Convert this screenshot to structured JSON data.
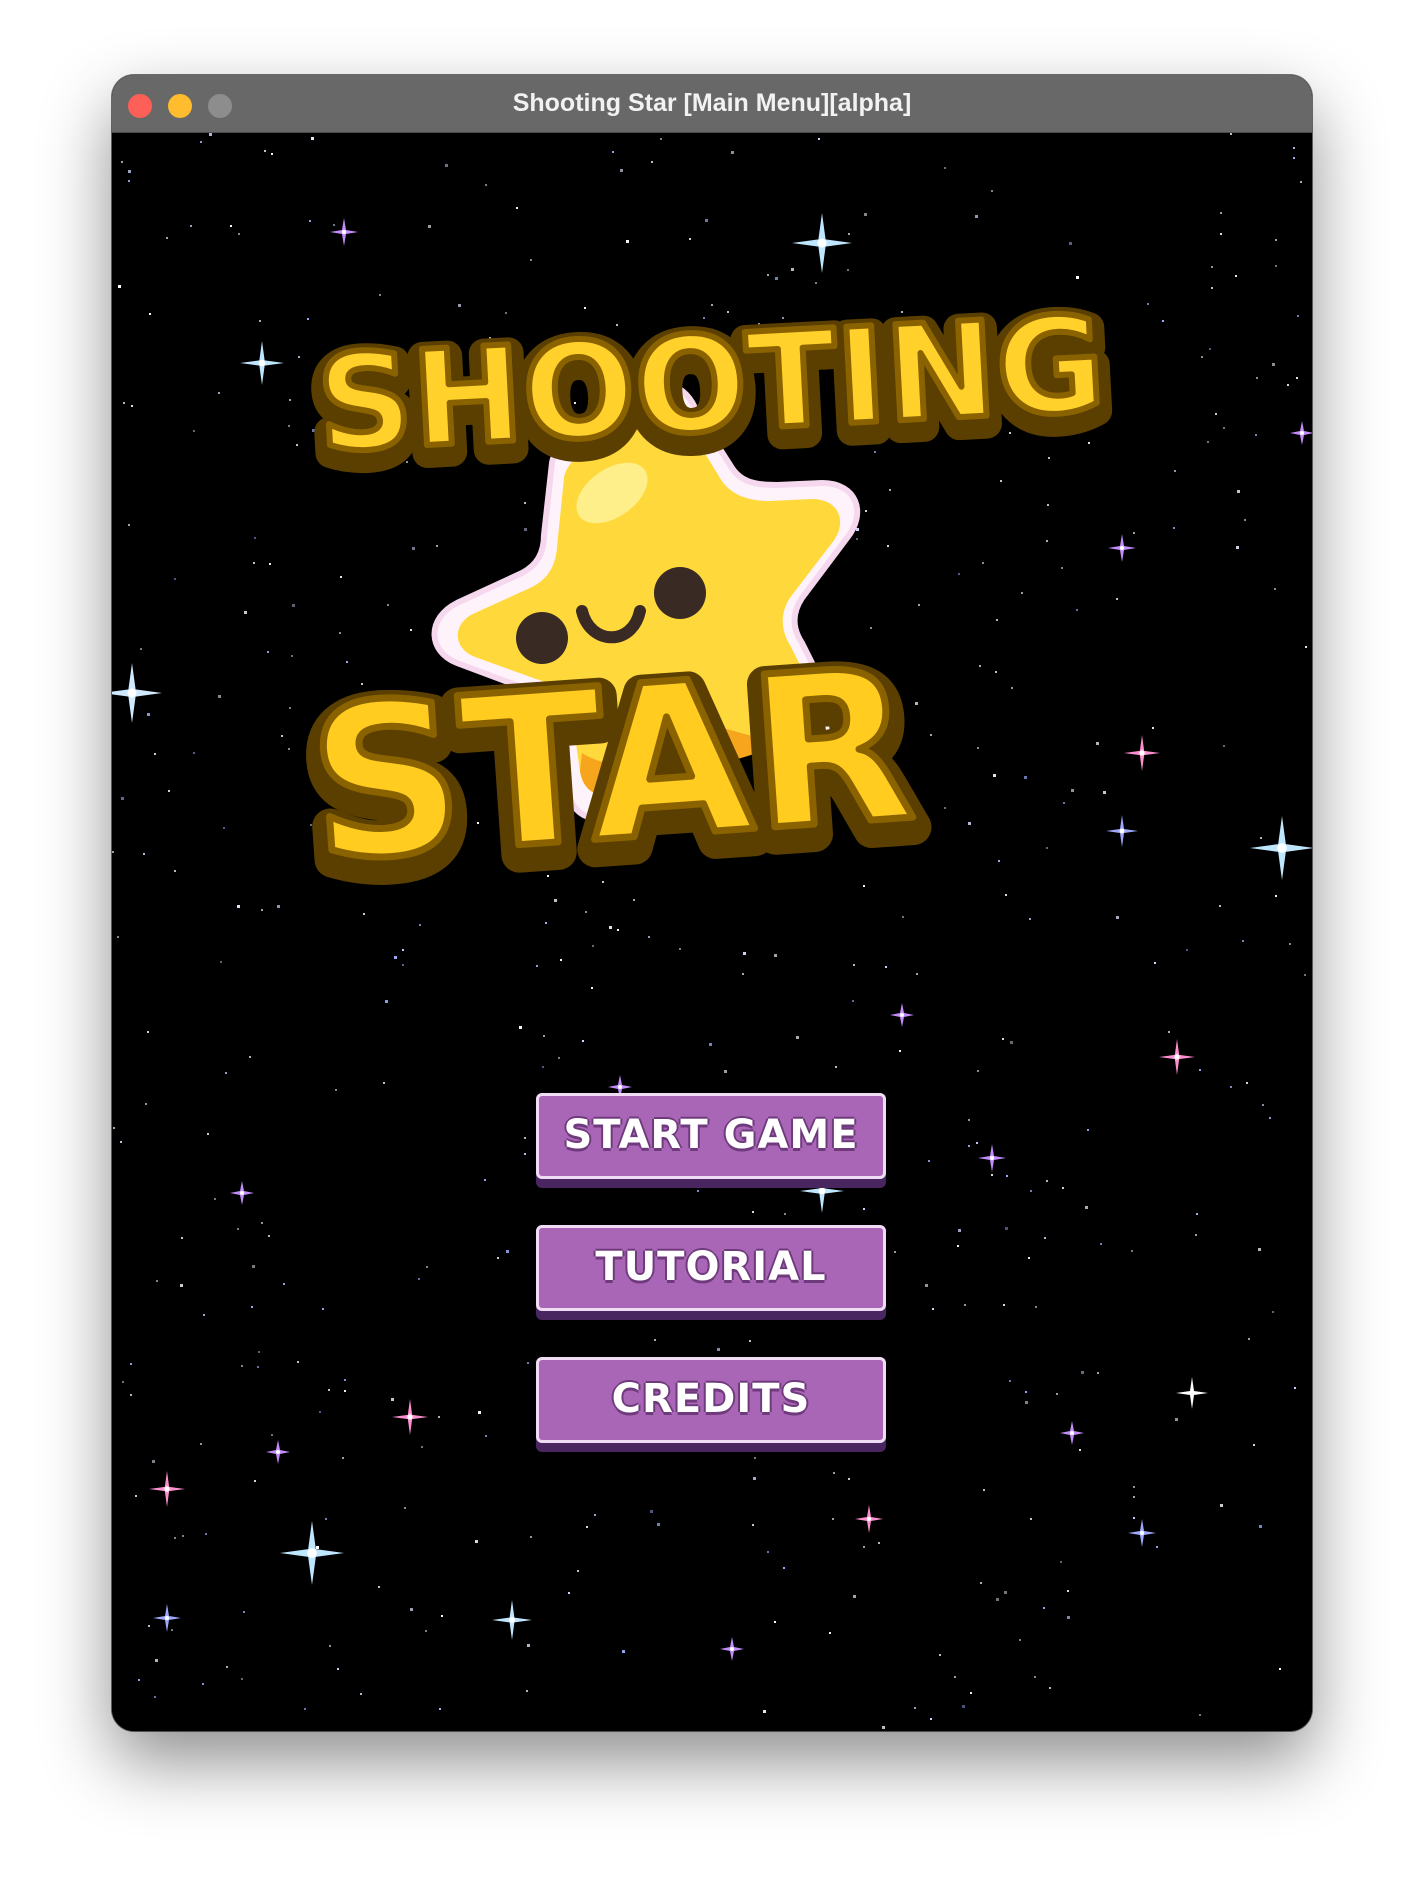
{
  "window": {
    "title": "Shooting Star [Main Menu][alpha]"
  },
  "logo": {
    "line1": "SHOOTING",
    "line2": "STAR"
  },
  "menu": {
    "start_label": "START GAME",
    "tutorial_label": "TUTORIAL",
    "credits_label": "CREDITS"
  },
  "colors": {
    "background": "#000000",
    "button": "#a966b6",
    "button_border": "#f1dcf6",
    "logo_yellow": "#ffd12a",
    "logo_outline": "#6b4a00",
    "mascot": "#ffd93b"
  }
}
